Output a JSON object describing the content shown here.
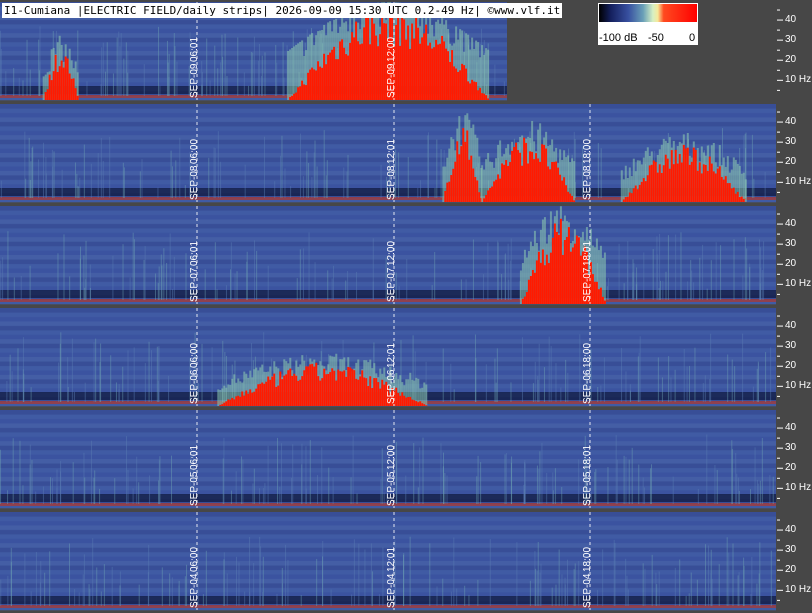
{
  "header": {
    "title": "I1-Cumiana |ELECTRIC FIELD/daily strips| 2026-09-09 15:30 UTC 0.2-49 Hz| ©www.vlf.it"
  },
  "legend": {
    "min_label": "-100 dB",
    "mid_label": "-50",
    "max_label": "0",
    "colors": [
      "#000000",
      "#1a2a7a",
      "#3f58a8",
      "#6f9cb8",
      "#b9e2b4",
      "#f3f3a0",
      "#ff6a30",
      "#ff0000"
    ]
  },
  "chart_data": {
    "type": "heatmap",
    "title": "I1-Cumiana |ELECTRIC FIELD/daily strips| 2026-09-09 15:30 UTC 0.2-49 Hz| ©www.vlf.it",
    "colorbar": {
      "min": -100,
      "max": 0,
      "unit": "dB",
      "ticks": [
        "-100 dB",
        "-50",
        "0"
      ]
    },
    "y_range_hz": [
      0.2,
      49
    ],
    "y_ticks": [
      "40",
      "30",
      "20",
      "10 Hz"
    ],
    "strips": [
      {
        "date": "SEP-09",
        "time_labels": [
          "06:01",
          "12:00"
        ],
        "end_fraction": 0.653
      },
      {
        "date": "SEP-08",
        "time_labels": [
          "06:00",
          "12:01",
          "18:00"
        ],
        "end_fraction": 1
      },
      {
        "date": "SEP-07",
        "time_labels": [
          "06:01",
          "12:00",
          "18:01"
        ],
        "end_fraction": 1
      },
      {
        "date": "SEP-06",
        "time_labels": [
          "06:00",
          "12:01",
          "18:00"
        ],
        "end_fraction": 1
      },
      {
        "date": "SEP-05",
        "time_labels": [
          "06:01",
          "12:00",
          "18:01"
        ],
        "end_fraction": 1
      },
      {
        "date": "SEP-04",
        "time_labels": [
          "06:00",
          "12:01",
          "18:00"
        ],
        "end_fraction": 1
      }
    ]
  }
}
